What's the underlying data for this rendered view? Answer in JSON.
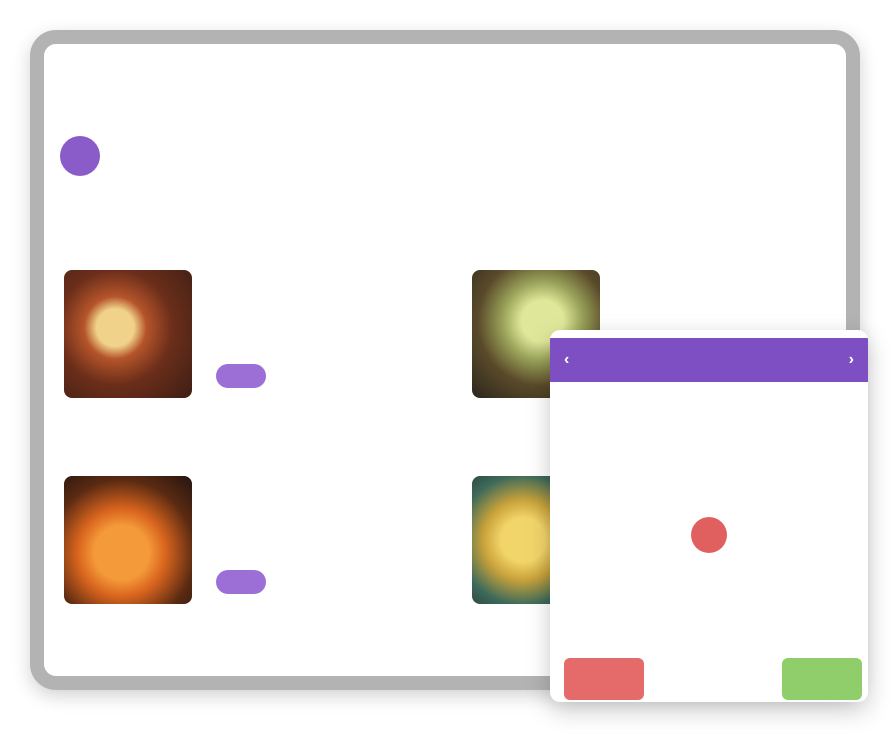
{
  "header": {
    "brand": "",
    "nav_calendar": "",
    "nav_account": ""
  },
  "week": {
    "badge": "",
    "label": ""
  },
  "section": {
    "label": ""
  },
  "recipes": [
    {
      "title": "",
      "desc": "",
      "tag": "",
      "meta": ""
    },
    {
      "title": "",
      "desc": "",
      "tag": "",
      "meta": ""
    },
    {
      "title": "",
      "desc": "",
      "tag": "",
      "meta": ""
    },
    {
      "title": "",
      "desc": "",
      "tag": "",
      "meta": ""
    }
  ],
  "footer": {
    "view_all": ""
  },
  "date_picker": {
    "title": "",
    "prev_icon": "chevron-left-icon",
    "next_icon": "chevron-right-icon",
    "weekdays": [
      "",
      "",
      "",
      "",
      "",
      "",
      ""
    ],
    "selected_index": 17,
    "cancel_label": "",
    "confirm_label": ""
  },
  "colors": {
    "accent": "#8a5cc9",
    "header_bar": "#7e4fc2",
    "selected_day": "#e06060",
    "cancel": "#e56a6a",
    "confirm": "#8fce6a",
    "frame": "#b3b3b3"
  }
}
